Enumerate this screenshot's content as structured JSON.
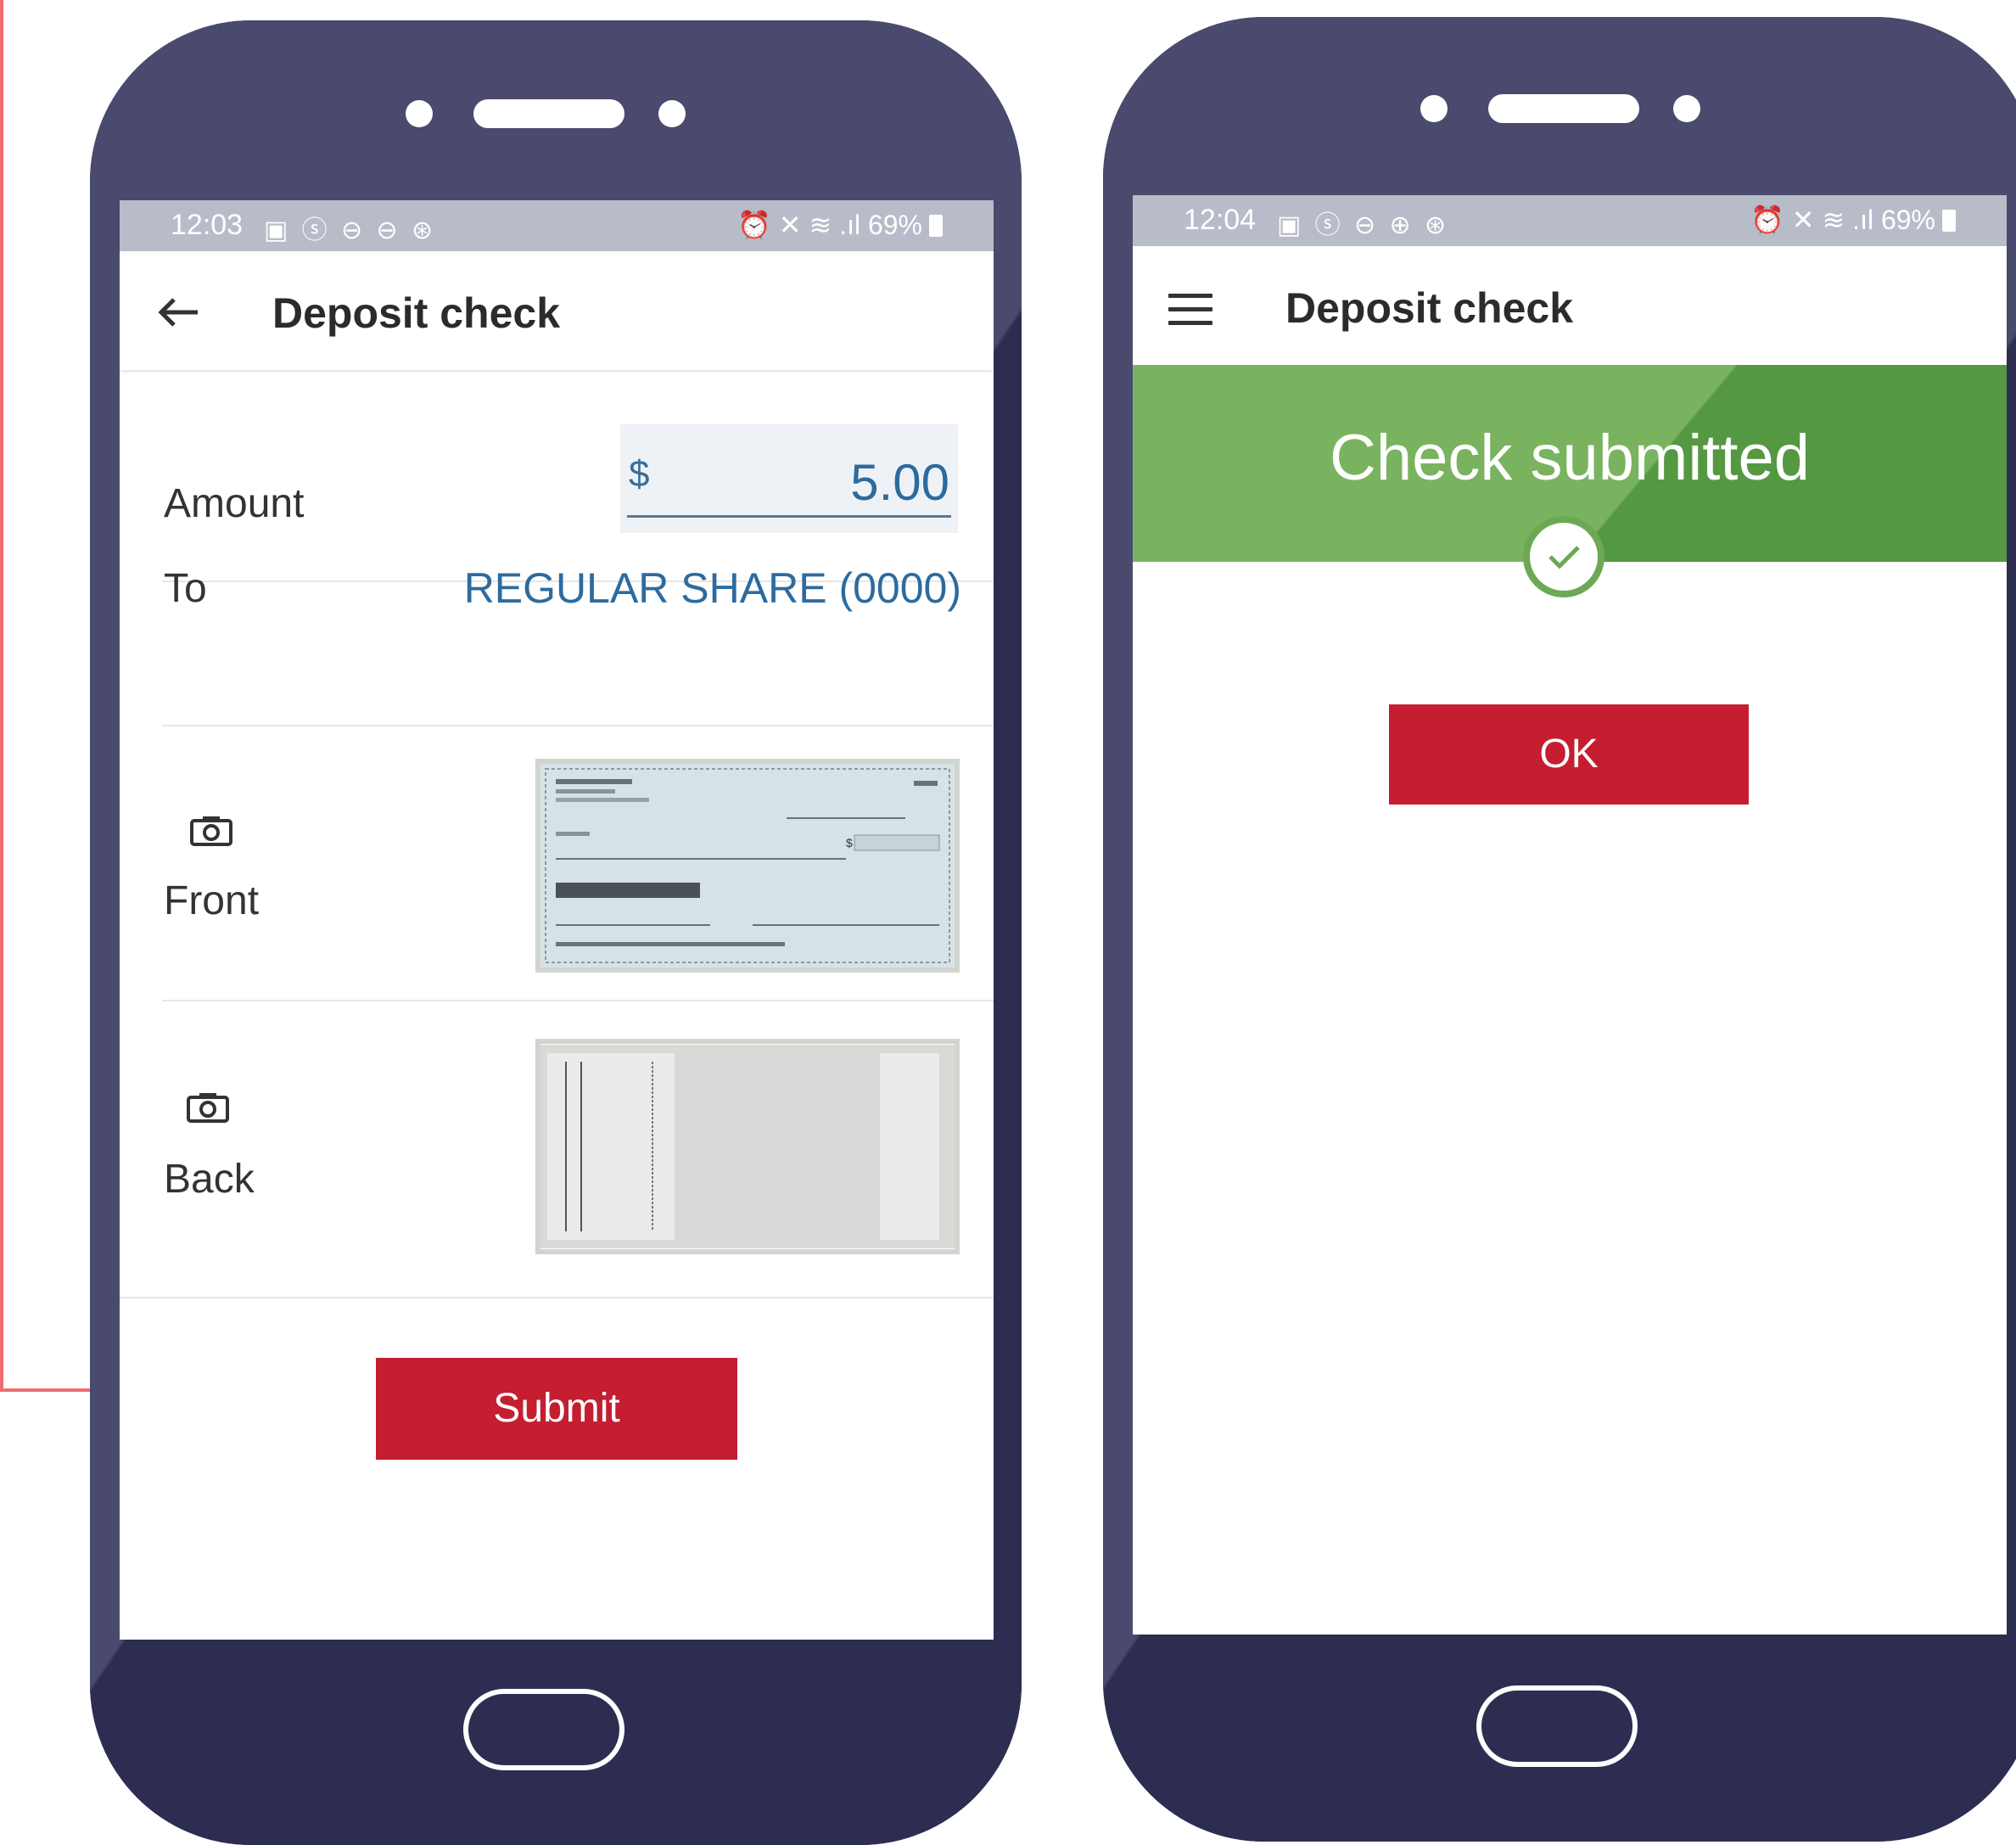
{
  "phone_left": {
    "status": {
      "time": "12:03",
      "left_icons": "▣ ⓢ ⊖ ⊖ ⊛",
      "right_icons": "⏰ ✕ ≋ .ıl",
      "battery": "69%"
    },
    "appbar": {
      "title": "Deposit check",
      "nav_icon": "back-arrow-icon"
    },
    "amount": {
      "label": "Amount",
      "currency": "$",
      "value": "5.00"
    },
    "to": {
      "label": "To",
      "account": "REGULAR SHARE (0000)"
    },
    "front": {
      "label": "Front",
      "icon": "camera-icon"
    },
    "back": {
      "label": "Back",
      "icon": "camera-icon"
    },
    "submit_label": "Submit"
  },
  "phone_right": {
    "status": {
      "time": "12:04",
      "left_icons": "▣ ⓢ ⊖ ⊕ ⊛",
      "right_icons": "⏰ ✕ ≋ .ıl",
      "battery": "69%"
    },
    "appbar": {
      "title": "Deposit check",
      "nav_icon": "hamburger-menu-icon"
    },
    "banner_title": "Check submitted",
    "ok_label": "OK"
  },
  "colors": {
    "accent_red": "#c41e30",
    "link_blue": "#2d6b9e",
    "success_green": "#7ab35f",
    "phone_body": "#2d2d52",
    "arrow": "#ef6b6f"
  }
}
